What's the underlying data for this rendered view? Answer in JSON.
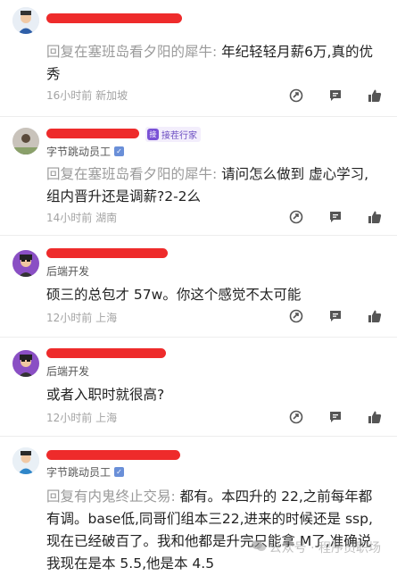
{
  "comments": [
    {
      "reply_prefix": "回复在塞班岛看夕阳的犀牛:",
      "text": "年纪轻轻月薪6万,真的优秀",
      "time": "16小时前",
      "location": "新加坡"
    },
    {
      "user_tag": "接茬行家",
      "subtitle": "字节跳动员工",
      "reply_prefix": "回复在塞班岛看夕阳的犀牛:",
      "text": "请问怎么做到 虚心学习,组内晋升还是调薪?2-2么",
      "time": "14小时前",
      "location": "湖南"
    },
    {
      "subtitle": "后端开发",
      "text": "硕三的总包才 57w。你这个感觉不太可能",
      "time": "12小时前",
      "location": "上海"
    },
    {
      "subtitle": "后端开发",
      "text": "或者入职时就很高?",
      "time": "12小时前",
      "location": "上海"
    },
    {
      "subtitle": "字节跳动员工",
      "reply_prefix": "回复有内鬼终止交易:",
      "text": "都有。本四升的 22,之前每年都有调。base低,同哥们组本三22,进来的时候还是 ssp,现在已经破百了。我和他都是升完只能拿 M了,准确说我现在是本 5.5,他是本 4.5"
    }
  ],
  "watermark": "公众号 · 程序员职场",
  "icons": {
    "forward": "forward-icon",
    "comment": "comment-icon",
    "like": "thumb-up-icon"
  },
  "colors": {
    "redaction": "#ee2b2b",
    "verify": "#6a8fd8",
    "tag": "#7a52d6"
  }
}
